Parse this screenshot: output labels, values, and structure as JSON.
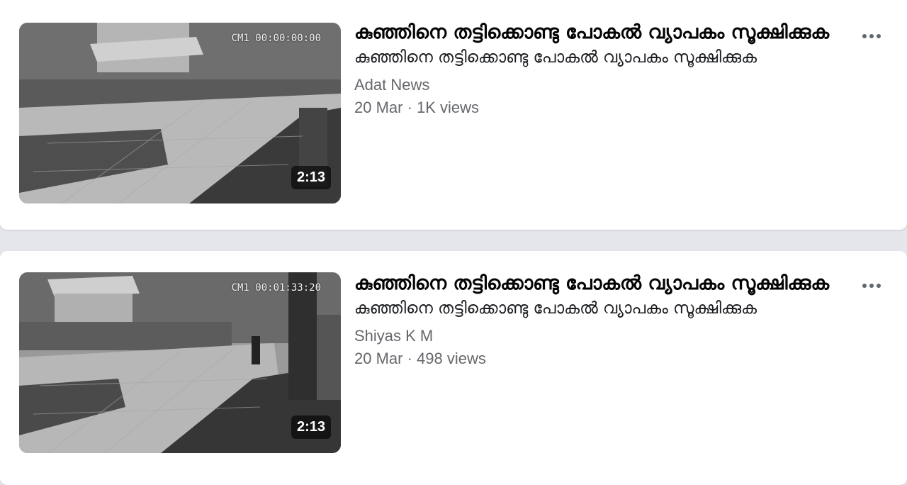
{
  "videos": [
    {
      "title": "കുഞ്ഞിനെ തട്ടിക്കൊണ്ടു പോകൽ വ്യാപകം സൂക്ഷിക്കുക",
      "description": "കുഞ്ഞിനെ തട്ടിക്കൊണ്ടു പോകൽ വ്യാപകം സൂക്ഷിക്കുക",
      "channel": "Adat News",
      "meta": "20 Mar · 1K views",
      "duration": "2:13",
      "camera_timestamp": "CM1 00:00:00:00",
      "menu_icon": "more-horizontal-icon"
    },
    {
      "title": "കുഞ്ഞിനെ തട്ടിക്കൊണ്ടു പോകൽ വ്യാപകം സൂക്ഷിക്കുക",
      "description": "കുഞ്ഞിനെ തട്ടിക്കൊണ്ടു പോകൽ വ്യാപകം സൂക്ഷിക്കുക",
      "channel": "Shiyas K M",
      "meta": "20 Mar · 498 views",
      "duration": "2:13",
      "camera_timestamp": "CM1 00:01:33:20",
      "menu_icon": "more-horizontal-icon"
    }
  ],
  "colors": {
    "page_background": "#e4e6eb",
    "card_background": "#ffffff",
    "secondary_text": "#65676b",
    "primary_text": "#050505"
  }
}
